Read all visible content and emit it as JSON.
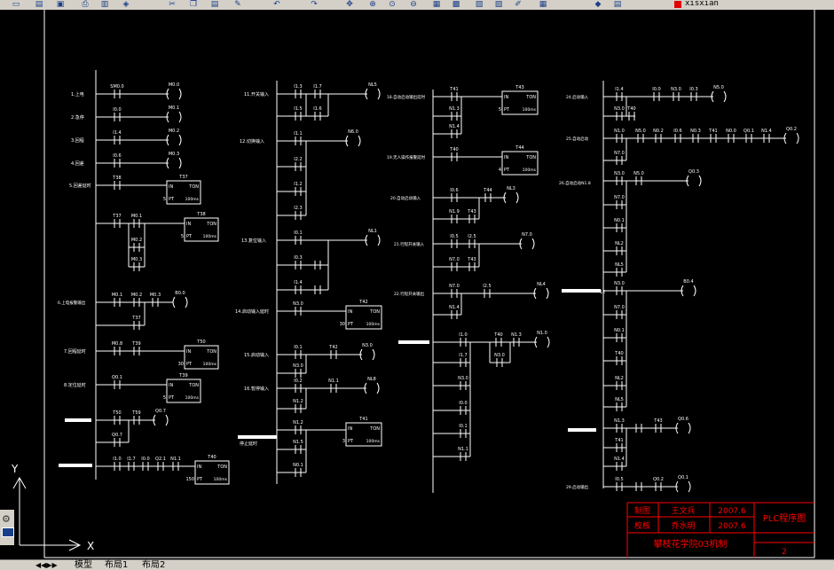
{
  "toolbar": {
    "icons": [
      "new-icon",
      "open-icon",
      "save-icon",
      "print-icon",
      "preview-icon",
      "publish-icon",
      "cut-icon",
      "copy-icon",
      "paste-icon",
      "match-icon",
      "undo-icon",
      "redo-icon",
      "pan-icon",
      "zoom-realtime-icon",
      "zoom-window-icon",
      "zoom-previous-icon",
      "properties-icon",
      "designcenter-icon",
      "toolpalette-icon",
      "sheetset-icon",
      "markup-icon",
      "calc-icon",
      "layers-icon",
      "layer-state-icon"
    ],
    "layer_name": "xisxian"
  },
  "colors": {
    "canvas": "#000000",
    "wire": "#ffffff",
    "label": "#ffffff",
    "title_block": "#ff0000"
  },
  "ladder": {
    "col1": {
      "labels": [
        "1.上电",
        "2.急停",
        "3.回程",
        "4.回差",
        "5.回差延时",
        "6.上电报警输出",
        "7.回程延时",
        "8.定位延时"
      ],
      "contacts": [
        "SM0.0",
        "I0.0",
        "I1.4",
        "I0.6",
        "T38",
        "T37",
        "M0.1",
        "M0.2",
        "M0.3",
        "M0.1",
        "M0.2",
        "M0.3",
        "T37",
        "M0.8",
        "T39",
        "Q0.1",
        "T50",
        "T59",
        "Q0.7",
        "I1.0",
        "I1.7",
        "I0.0",
        "Q2.1",
        "N1.1"
      ],
      "coils": [
        "M0.0",
        "M0.1",
        "M0.2",
        "M0.3",
        "T37",
        "T38",
        "B0.0",
        "T50",
        "T39",
        "Q0.7",
        "T40"
      ],
      "timer_pts": [
        "5",
        "5",
        "30",
        "5",
        "150"
      ],
      "timer_base": "100ms",
      "timer_in": "IN",
      "timer_ton": "TON",
      "timer_pt": "PT"
    },
    "col2": {
      "labels": [
        "11.开关输入",
        "12.切换输入",
        "13.复位输入",
        "14.启动输入延时",
        "15.启动输入",
        "16.暂停输入",
        "停止延时"
      ],
      "contacts": [
        "I1.3",
        "I1.7",
        "I1.5",
        "I1.6",
        "I1.1",
        "I2.2",
        "I1.2",
        "I2.3",
        "I0.1",
        "I0.3",
        "I1.4",
        "N3.0",
        "I0.1",
        "T42",
        "N3.0",
        "I0.2",
        "N1.1",
        "N1.2",
        "N1.2",
        "N1.5",
        "N0.1"
      ],
      "coils": [
        "NL5",
        "N6.0",
        "NL1",
        "T42",
        "N3.0",
        "NL8",
        "T41"
      ],
      "timer_pts": [
        "30",
        "3"
      ]
    },
    "col3": {
      "labels": [
        "18.自动启动输出延时",
        "19.无人操作报警延时",
        "20.自动启动输入",
        "21.行程开关输入",
        "22.行程开关输出"
      ],
      "contacts": [
        "T41",
        "N1.3",
        "N1.4",
        "T40",
        "I0.6",
        "T44",
        "N1.9",
        "T43",
        "I0.5",
        "I2.5",
        "N7.0",
        "T43",
        "N7.0",
        "I2.5",
        "N1.4",
        "I1.0",
        "T40",
        "N1.3",
        "I1.7",
        "N3.0",
        "I0.0",
        "I0.1",
        "N1.1",
        "N1.0"
      ],
      "coils": [
        "T43",
        "T44",
        "NL3",
        "N7.0",
        "NL4",
        "N1.0"
      ],
      "timer_pts": [
        "5",
        "4"
      ]
    },
    "col4": {
      "labels": [
        "24.启动输入",
        "25.自动启动",
        "26.自动启动N1.8",
        "29.启动输出"
      ],
      "contacts": [
        "I1.4",
        "I0.0",
        "N3.0",
        "I0.3",
        "N3.0",
        "T40",
        "N1.0",
        "N5.0",
        "N0.2",
        "I0.6",
        "N0.3",
        "T41",
        "N0.0",
        "Q0.1",
        "N1.4",
        "N7.0",
        "N3.0",
        "N5.0",
        "N7.0",
        "N0.1",
        "NL2",
        "NL5",
        "N3.0",
        "N7.0",
        "N0.1",
        "T40",
        "NL2",
        "NL5",
        "N1.3",
        "T43",
        "T41",
        "N1.4",
        "I0.5",
        "Q0.2"
      ],
      "coils": [
        "N5.0",
        "Q0.2",
        "Q0.3",
        "B0.4",
        "Q0.6",
        "Q0.1"
      ]
    }
  },
  "title_block": {
    "row1": [
      "制图",
      "王文兵",
      "2007.6"
    ],
    "row2": [
      "校核",
      "乔水明",
      "2007.6"
    ],
    "title": "PLC程序图",
    "school": "攀枝花学院03机制",
    "sheet": "2"
  },
  "ucs": {
    "x": "X",
    "y": "Y"
  },
  "tabs": [
    "模型",
    "布局1",
    "布局2"
  ]
}
